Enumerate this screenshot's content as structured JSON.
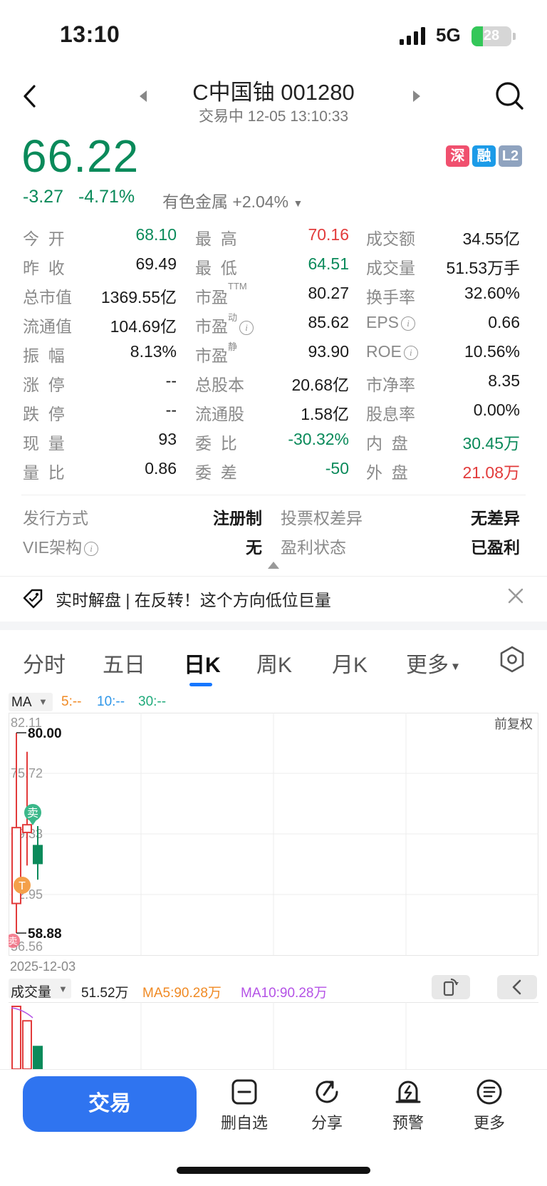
{
  "status": {
    "time": "13:10",
    "network": "5G",
    "battery": "28",
    "battery_level": 0.28
  },
  "header": {
    "title": "C中国铀 001280",
    "subtitle": "交易中 12-05 13:10:33"
  },
  "quote": {
    "price": "66.22",
    "change": "-3.27",
    "change_pct": "-4.71%",
    "sector": "有色金属 +2.04%",
    "badges": [
      {
        "label": "深",
        "color": "#f0506e"
      },
      {
        "label": "融",
        "color": "#1c9be8"
      },
      {
        "label": "L2",
        "color": "#8fa3bf"
      }
    ]
  },
  "stats": [
    [
      {
        "label": "今  开",
        "value": "68.10",
        "tone": "green"
      },
      {
        "label": "最  高",
        "value": "70.16",
        "tone": "red"
      },
      {
        "label": "成交额",
        "value": "34.55亿",
        "tone": ""
      }
    ],
    [
      {
        "label": "昨  收",
        "value": "69.49",
        "tone": ""
      },
      {
        "label": "最  低",
        "value": "64.51",
        "tone": "green"
      },
      {
        "label": "成交量",
        "value": "51.53万手",
        "tone": ""
      }
    ],
    [
      {
        "label": "总市值",
        "value": "1369.55亿",
        "tone": ""
      },
      {
        "label": "市盈",
        "sup": "TTM",
        "value": "80.27",
        "tone": ""
      },
      {
        "label": "换手率",
        "value": "32.60%",
        "tone": ""
      }
    ],
    [
      {
        "label": "流通值",
        "value": "104.69亿",
        "tone": ""
      },
      {
        "label": "市盈",
        "sup": "动",
        "info": true,
        "value": "85.62",
        "tone": ""
      },
      {
        "label": "EPS",
        "info": true,
        "value": "0.66",
        "tone": ""
      }
    ],
    [
      {
        "label": "振  幅",
        "value": "8.13%",
        "tone": ""
      },
      {
        "label": "市盈",
        "sup": "静",
        "value": "93.90",
        "tone": ""
      },
      {
        "label": "ROE",
        "info": true,
        "value": "10.56%",
        "tone": ""
      }
    ],
    [
      {
        "label": "涨  停",
        "value": "--",
        "tone": ""
      },
      {
        "label": "总股本",
        "value": "20.68亿",
        "tone": ""
      },
      {
        "label": "市净率",
        "value": "8.35",
        "tone": ""
      }
    ],
    [
      {
        "label": "跌  停",
        "value": "--",
        "tone": ""
      },
      {
        "label": "流通股",
        "value": "1.58亿",
        "tone": ""
      },
      {
        "label": "股息率",
        "value": "0.00%",
        "tone": ""
      }
    ],
    [
      {
        "label": "现  量",
        "value": "93",
        "tone": ""
      },
      {
        "label": "委  比",
        "value": "-30.32%",
        "tone": "green"
      },
      {
        "label": "内  盘",
        "value": "30.45万",
        "tone": "green"
      }
    ],
    [
      {
        "label": "量  比",
        "value": "0.86",
        "tone": ""
      },
      {
        "label": "委  差",
        "value": "-50",
        "tone": "green"
      },
      {
        "label": "外  盘",
        "value": "21.08万",
        "tone": "red"
      }
    ]
  ],
  "extra": [
    {
      "label": "发行方式",
      "value": "注册制"
    },
    {
      "label": "投票权差异",
      "value": "无差异"
    },
    {
      "label": "VIE架构",
      "value": "无",
      "info": true
    },
    {
      "label": "盈利状态",
      "value": "已盈利"
    }
  ],
  "banner": {
    "text": "实时解盘 | 在反转！这个方向低位巨量"
  },
  "tabs": [
    {
      "label": "分时",
      "active": false
    },
    {
      "label": "五日",
      "active": false
    },
    {
      "label": "日K",
      "active": true
    },
    {
      "label": "周K",
      "active": false
    },
    {
      "label": "月K",
      "active": false
    },
    {
      "label": "更多",
      "active": false,
      "dropdown": true
    }
  ],
  "chart": {
    "indicator": "MA",
    "ma5": "5:--",
    "ma10": "10:--",
    "ma30": "30:--",
    "adjust": "前复权",
    "date": "2025-12-03",
    "y_ticks": [
      "82.11",
      "75.72",
      "69.33",
      "62.95",
      "56.56"
    ],
    "high_label": "80.00",
    "low_label": "58.88",
    "markers": {
      "sell": "卖",
      "t": "T",
      "sell2": "卖"
    }
  },
  "chart_data": {
    "type": "candlestick",
    "ylim": [
      56.56,
      82.11
    ],
    "candles": [
      {
        "open": 62.0,
        "close": 70.0,
        "high": 80.0,
        "low": 58.88,
        "color": "red"
      },
      {
        "open": 69.49,
        "close": 70.3,
        "high": 78.0,
        "low": 66.0,
        "color": "red"
      },
      {
        "open": 68.1,
        "close": 66.22,
        "high": 70.16,
        "low": 64.51,
        "color": "green"
      }
    ],
    "volume": {
      "label": "成交量",
      "value": "51.52万",
      "ma5": "MA5:90.28万",
      "ma10": "MA10:90.28万"
    },
    "volumes": [
      1.0,
      0.77,
      0.36
    ]
  },
  "bottom": {
    "trade": "交易",
    "items": [
      {
        "label": "删自选",
        "icon": "remove-watchlist-icon"
      },
      {
        "label": "分享",
        "icon": "share-icon"
      },
      {
        "label": "预警",
        "icon": "alert-icon"
      },
      {
        "label": "更多",
        "icon": "more-icon"
      }
    ]
  }
}
